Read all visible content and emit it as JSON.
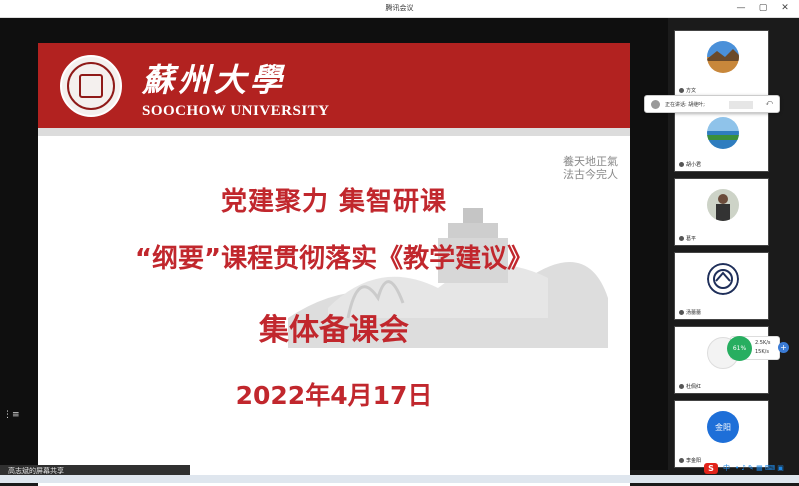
{
  "window": {
    "title": "腾讯会议",
    "min_glyph": "—",
    "max_glyph": "▢",
    "close_glyph": "✕"
  },
  "slide": {
    "brand_cn": "蘇州大學",
    "brand_en": "SOOCHOW UNIVERSITY",
    "line1": "党建聚力  集智研课",
    "line2": "“纲要”课程贯彻落实《教学建议》",
    "line3": "集体备课会",
    "line4": "2022年4月17日",
    "calligraphy": [
      "養天地正氣",
      "法古今完人"
    ]
  },
  "participants": [
    {
      "name": "方文",
      "avatar": "landscape"
    },
    {
      "name": "胡小君",
      "avatar": "lake"
    },
    {
      "name": "葛平",
      "avatar": "person"
    },
    {
      "name": "汤蕾蕾",
      "avatar": "emblem"
    },
    {
      "name": "杜佩红",
      "avatar": "white"
    },
    {
      "name": "李金阳",
      "avatar_text": "金阳"
    }
  ],
  "speaking": {
    "text": "正在讲话: 胡继叶;",
    "button": "⤺"
  },
  "network": {
    "percent": "61%",
    "up": "2.5K/s",
    "down": "15K/s",
    "plus": "+"
  },
  "share_banner": "高志斌的屏幕共享",
  "side_handle": "⋮≡",
  "tray": {
    "ime_logo": "S",
    "ime_mode": "中",
    "icons": "• ♪ ✎ ▦ ⌨ ▣"
  },
  "colors": {
    "header_red": "#b22220",
    "title_red": "#c1272d",
    "meeting_blue": "#1e6fd8",
    "gauge_green": "#27ae60"
  }
}
